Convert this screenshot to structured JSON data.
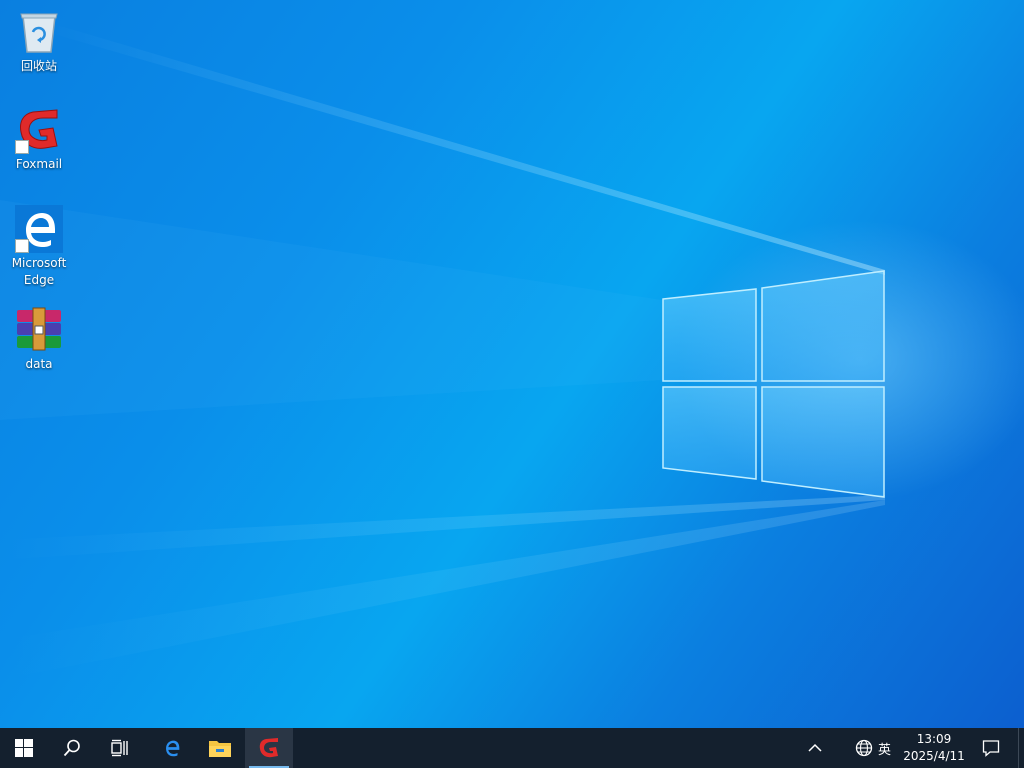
{
  "desktop": {
    "icons": [
      {
        "label": "回收站",
        "icon": "recycle-bin-icon"
      },
      {
        "label": "Foxmail",
        "icon": "foxmail-icon"
      },
      {
        "label": "Microsoft Edge",
        "icon": "edge-icon"
      },
      {
        "label": "data",
        "icon": "winrar-archive-icon"
      }
    ]
  },
  "taskbar": {
    "buttons": [
      {
        "icon": "windows-start-icon"
      },
      {
        "icon": "search-icon"
      },
      {
        "icon": "task-view-icon"
      },
      {
        "icon": "edge-icon"
      },
      {
        "icon": "file-explorer-icon"
      },
      {
        "icon": "foxmail-icon"
      }
    ],
    "tray": {
      "overflow_icon": "chevron-up-icon",
      "network_icon": "globe-icon",
      "ime_label": "英",
      "time": "13:09",
      "date": "2025/4/11",
      "notification_icon": "action-center-icon"
    }
  },
  "colors": {
    "wallpaper_blue": "#0a8eea",
    "taskbar": "#14202e",
    "accent": "#76b9ed",
    "foxmail_red": "#e02a2a"
  }
}
